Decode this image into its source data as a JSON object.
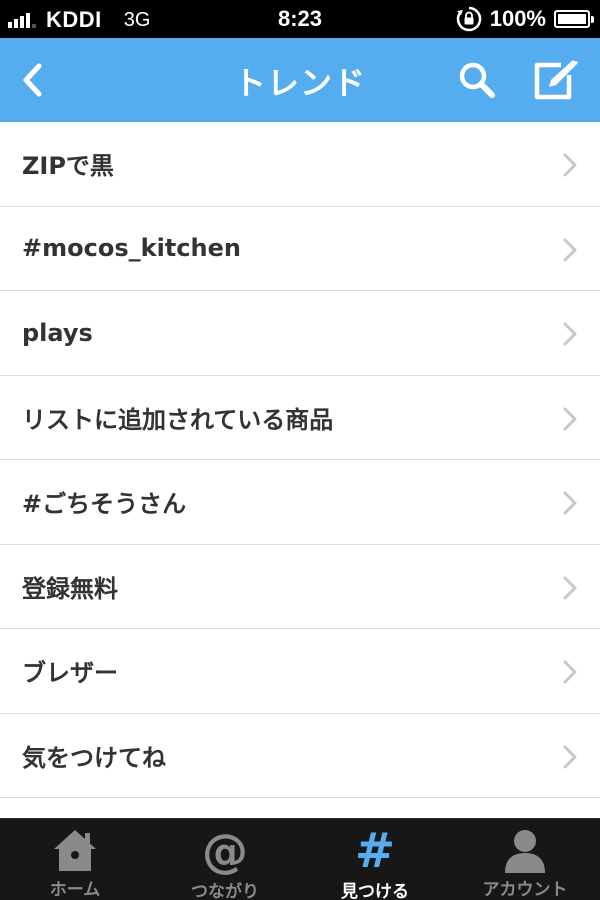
{
  "status_bar": {
    "carrier": "KDDI",
    "network": "3G",
    "time": "8:23",
    "battery": "100%"
  },
  "nav": {
    "title": "トレンド",
    "back_icon": "chevron-left-icon",
    "search_icon": "search-icon",
    "compose_icon": "compose-icon"
  },
  "trends": [
    {
      "label": "ZIPで黒"
    },
    {
      "label": "#mocos_kitchen"
    },
    {
      "label": "plays"
    },
    {
      "label": "リストに追加されている商品"
    },
    {
      "label": "#ごちそうさん"
    },
    {
      "label": "登録無料"
    },
    {
      "label": "ブレザー"
    },
    {
      "label": "気をつけてね"
    }
  ],
  "tabs": [
    {
      "label": "ホーム",
      "icon": "home-icon",
      "active": false
    },
    {
      "label": "つながり",
      "icon": "at-icon",
      "active": false
    },
    {
      "label": "見つける",
      "icon": "hashtag-icon",
      "active": true
    },
    {
      "label": "アカウント",
      "icon": "person-icon",
      "active": false
    }
  ],
  "colors": {
    "accent": "#55acee",
    "tab_bar_bg": "#171717",
    "text": "#333333",
    "divider": "#dddddd"
  }
}
